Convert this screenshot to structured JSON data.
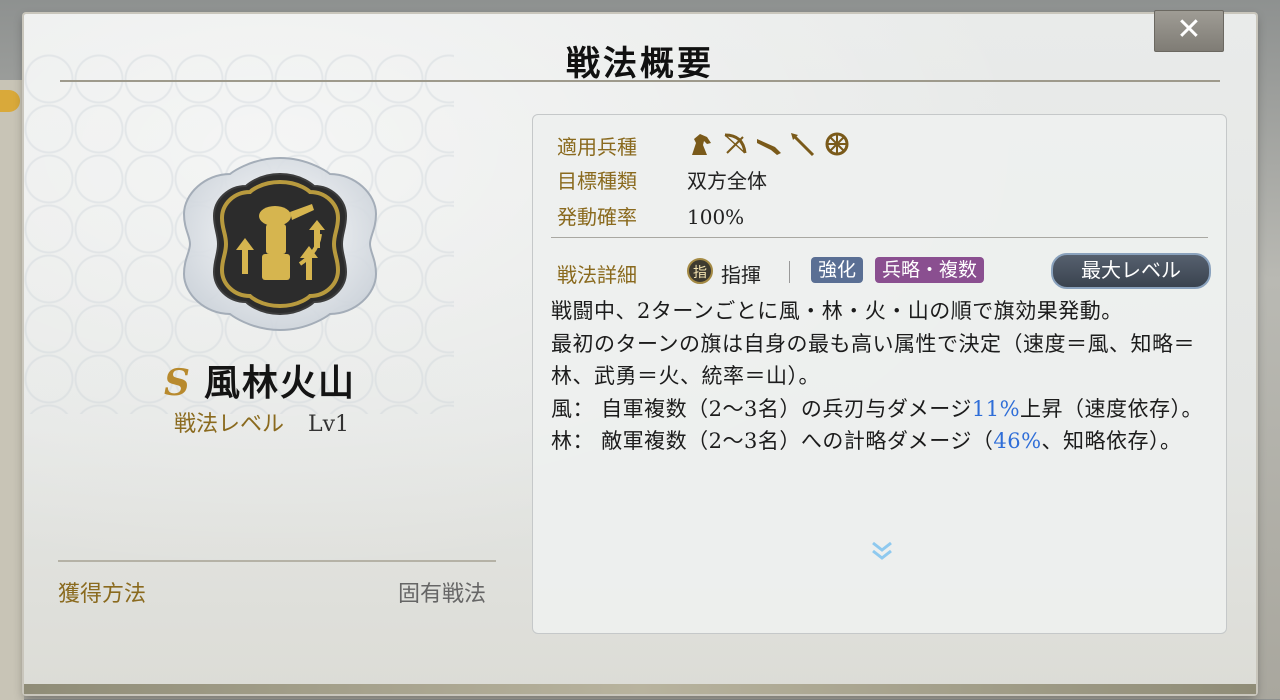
{
  "dialog": {
    "title": "戦法概要",
    "close_label": "✕"
  },
  "skill": {
    "grade": "S",
    "name": "風林火山",
    "level_label": "戦法レベル",
    "level_value": "Lv1",
    "acquisition_label": "獲得方法",
    "acquisition_value": "固有戦法"
  },
  "info": {
    "unit_label": "適用兵種",
    "unit_icons": [
      "cavalry-icon",
      "bow-icon",
      "gun-icon",
      "spear-icon",
      "cart-wheel-icon"
    ],
    "target_label": "目標種類",
    "target_value": "双方全体",
    "rate_label": "発動確率",
    "rate_value": "100%",
    "detail_label": "戦法詳細",
    "command_icon": "指",
    "command_label": "指揮",
    "tags": [
      "強化",
      "兵略・複数"
    ],
    "max_level_label": "最大レベル"
  },
  "description": {
    "line1": "戦闘中、2ターンごとに風・林・火・山の順で旗効果発動。",
    "line2": "最初のターンの旗は自身の最も高い属性で決定（速度＝風、知略＝林、武勇＝火、統率＝山）。",
    "wind_prefix": "風：  自軍複数（2〜3名）の兵刃与ダメージ",
    "wind_value": "11%",
    "wind_suffix": "上昇（速度依存）。",
    "forest_prefix": "林：  敵軍複数（2〜3名）への計略ダメージ（",
    "forest_value": "46%",
    "forest_suffix": "、知略依存）。"
  },
  "colors": {
    "accent_gold": "#8a6a1e",
    "highlight_blue": "#2f6ed8",
    "tag_blue": "#5a6f94",
    "tag_purple": "#8a4f90"
  }
}
